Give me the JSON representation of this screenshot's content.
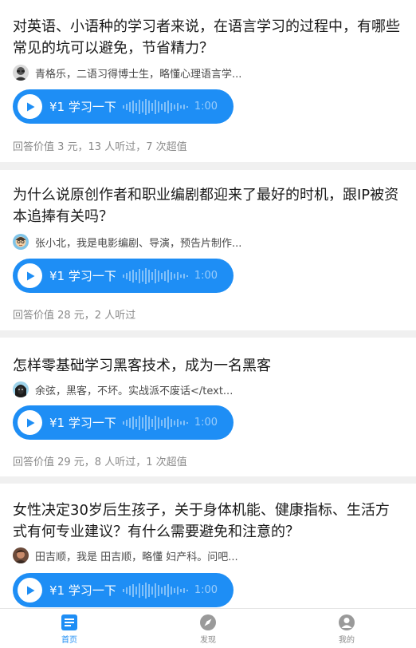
{
  "colors": {
    "accent": "#1e8ef5",
    "muted": "#8a8a8a"
  },
  "questions": [
    {
      "title": "对英语、小语种的学习者来说，在语言学习的过程中，有哪些常见的坑可以避免，节省精力？",
      "answerer": "青格乐，二语习得博士生，略懂心理语言学...",
      "avatar_icon": "avatar-man-glasses",
      "voice_label": "¥1 学习一下",
      "duration": "1:00",
      "stats": "回答价值 3 元，13 人听过，7 次超值"
    },
    {
      "title": "为什么说原创作者和职业编剧都迎来了最好的时机，跟IP被资本追捧有关吗？",
      "answerer": "张小北，我是电影编剧、导演，预告片制作...",
      "avatar_icon": "avatar-cartoon",
      "voice_label": "¥1 学习一下",
      "duration": "1:00",
      "stats": "回答价值 28 元，2 人听过"
    },
    {
      "title": "怎样零基础学习黑客技术，成为一名黑客",
      "answerer": "余弦，黑客，不坏。实战派不废话</text...",
      "avatar_icon": "avatar-hooded",
      "voice_label": "¥1 学习一下",
      "duration": "1:00",
      "stats": "回答价值 29 元，8 人听过，1 次超值"
    },
    {
      "title": "女性决定30岁后生孩子，关于身体机能、健康指标、生活方式有何专业建议？有什么需要避免和注意的？",
      "answerer": "田吉顺，我是 田吉顺，略懂 妇产科。问吧...",
      "avatar_icon": "avatar-photo",
      "voice_label": "¥1 学习一下",
      "duration": "1:00"
    }
  ],
  "tabbar": {
    "home": {
      "label": "首页",
      "icon": "home-icon"
    },
    "discover": {
      "label": "发现",
      "icon": "compass-icon"
    },
    "mine": {
      "label": "我的",
      "icon": "user-icon"
    }
  }
}
